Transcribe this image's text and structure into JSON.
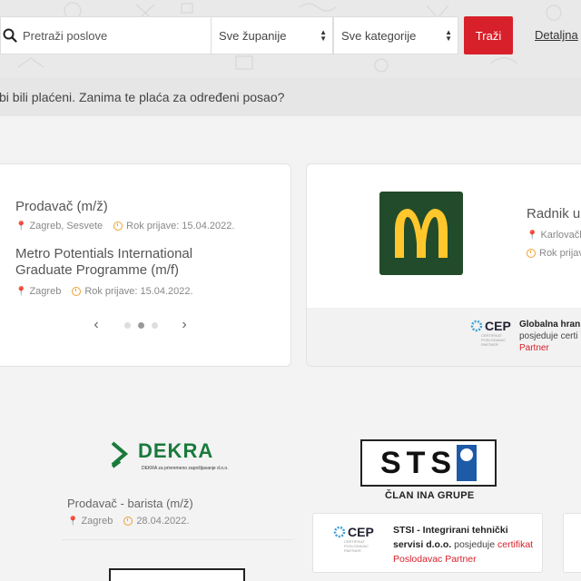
{
  "search": {
    "placeholder": "Pretraži poslove",
    "county_select": "Sve županije",
    "category_select": "Sve kategorije",
    "button_label": "Traži",
    "advanced_link": "Detaljna"
  },
  "info_bar": {
    "text": "bi bili plaćeni. Zanima te plaća za određeni posao?"
  },
  "card1": {
    "jobs": [
      {
        "title": "Prodavač (m/ž)",
        "location": "Zagreb, Sesvete",
        "deadline": "Rok prijave: 15.04.2022."
      },
      {
        "title": "Metro Potentials International Graduate Programme (m/f)",
        "location": "Zagreb",
        "deadline": "Rok prijave: 15.04.2022."
      }
    ],
    "pager": {
      "prev_icon": "chevron-left-icon",
      "next_icon": "chevron-right-icon",
      "dots": 3,
      "active_dot": 2
    }
  },
  "card2": {
    "logo": "mcdonalds-logo",
    "job_title": "Radnik u",
    "location": "Karlovačk",
    "deadline": "Rok prijave:",
    "cep_label": "CEP",
    "cert_company": "Globalna hran",
    "cert_line2": "posjeduje certi",
    "cert_line3": "Partner"
  },
  "bottom": {
    "dekra": {
      "name": "DEKRA",
      "subtitle": "DEKRA za privremeno zapošljavanje d.o.o.",
      "job_title": "Prodavač - barista (m/ž)",
      "location": "Zagreb",
      "deadline": "28.04.2022."
    },
    "sts": {
      "logo_text": "STS",
      "tagline": "ČLAN INA GRUPE",
      "cep_label": "CEP",
      "cert_company": "STSI - Integrirani tehnički servisi d.o.o.",
      "cert_owns": "posjeduje",
      "cert_link": "certifikat Poslodavac Partner"
    }
  },
  "colors": {
    "accent_red": "#d8202a",
    "meta_orange": "#f0a030",
    "mcd_green": "#224b2b",
    "mcd_yellow": "#ffc72c",
    "dekra_green": "#1a7a3c"
  }
}
